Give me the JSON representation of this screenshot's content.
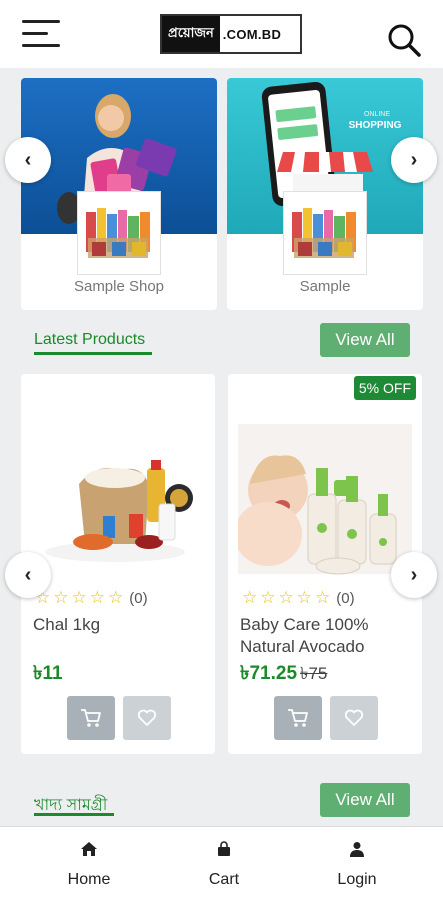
{
  "header": {
    "logo_bn": "প্রয়োজন",
    "logo_en": ".COM.BD"
  },
  "shops": [
    {
      "name": "Sample Shop",
      "banner_text": ""
    },
    {
      "name": "Sample",
      "banner_text_1": "ONLINE",
      "banner_text_2": "SHOPPING"
    }
  ],
  "sections": {
    "latest_title": "Latest Products",
    "food_title": "খাদ্য সামগ্রী",
    "view_all": "View All"
  },
  "products": [
    {
      "title": "Chal 1kg",
      "rating_count": "(0)",
      "price": "৳11",
      "old_price": "",
      "badge": ""
    },
    {
      "title": "Baby Care 100% Natural Avocado",
      "rating_count": "(0)",
      "price": "৳71.25",
      "old_price": "৳75",
      "badge": "5% OFF"
    }
  ],
  "nav": {
    "home": "Home",
    "cart": "Cart",
    "login": "Login"
  },
  "icons": {
    "prev": "‹",
    "next": "›",
    "star": "☆"
  },
  "colors": {
    "accent_green": "#1a8a2a",
    "button_green": "#5fae72"
  }
}
